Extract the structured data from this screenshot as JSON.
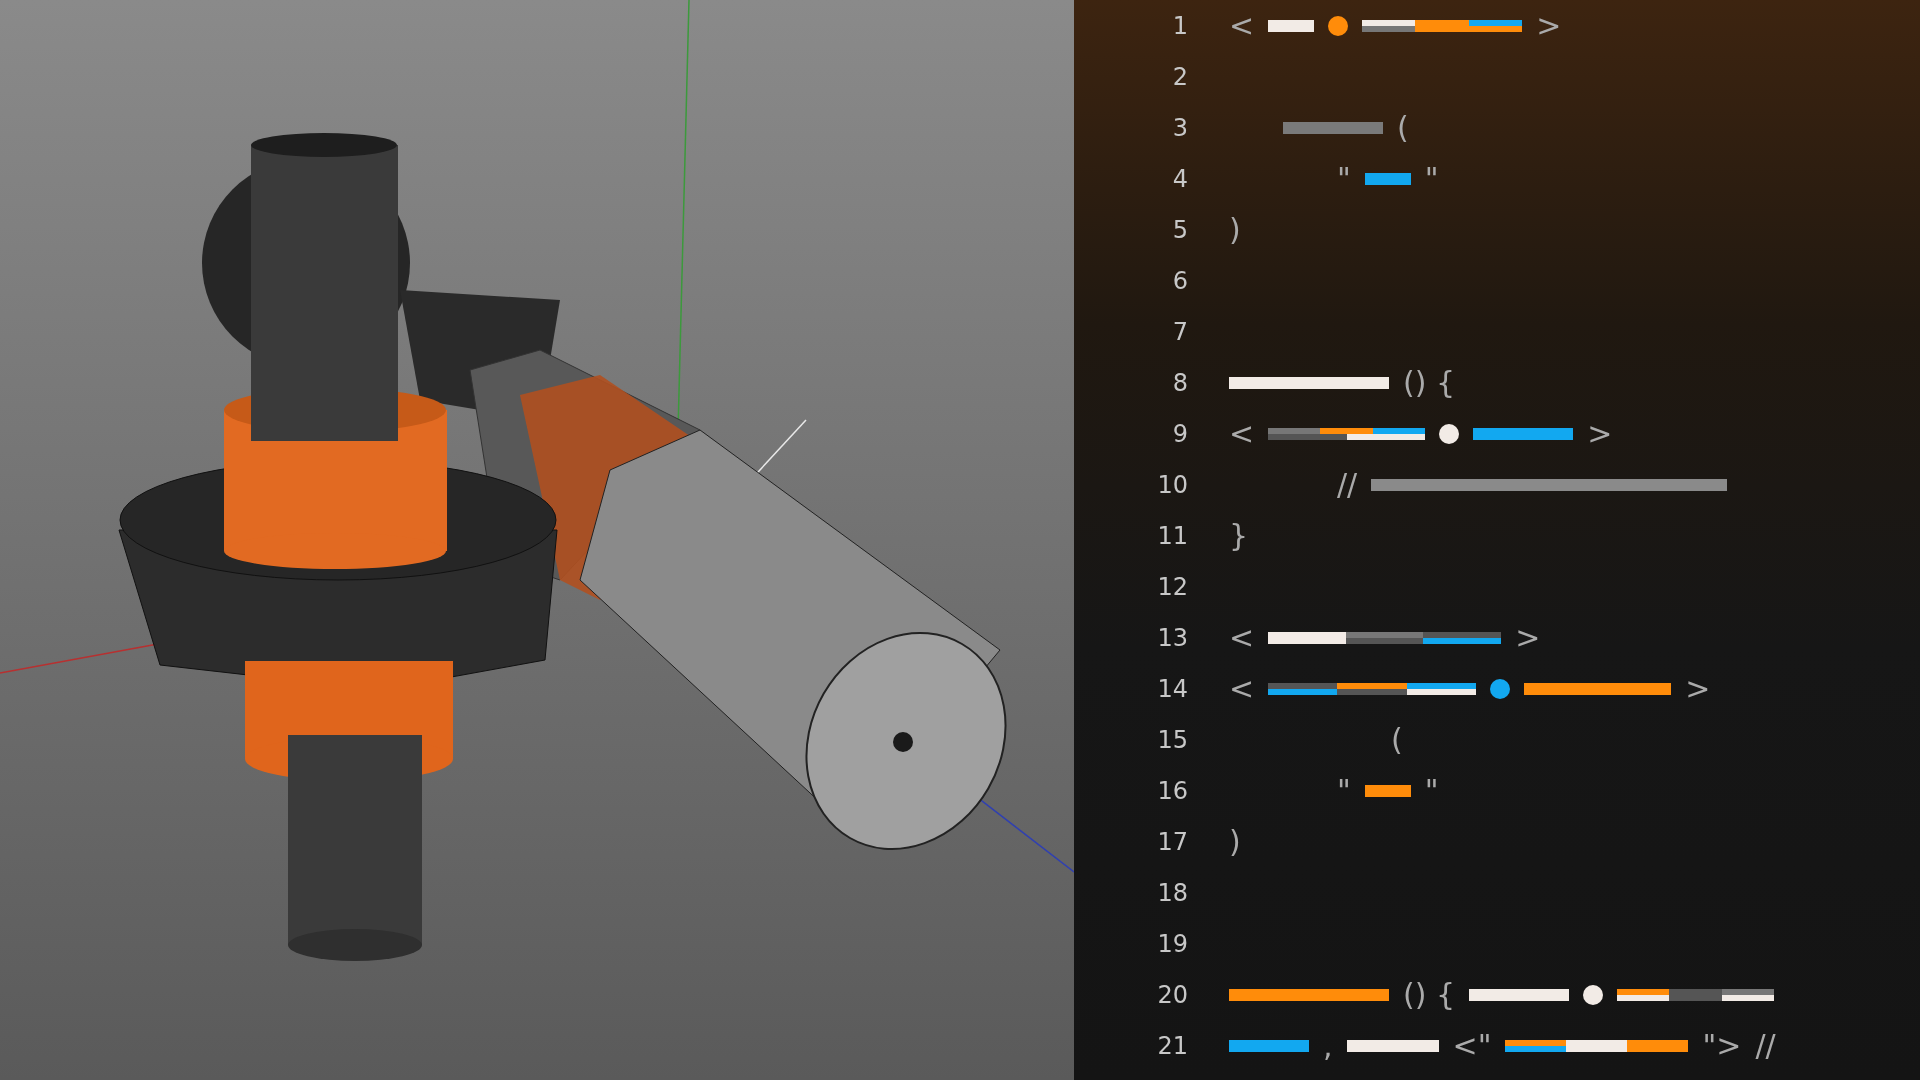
{
  "editor": {
    "lines": [
      {
        "number": "1",
        "tokens": [
          {
            "kind": "text",
            "text": "<"
          },
          {
            "kind": "bar",
            "color": "#f2ebe6"
          },
          {
            "kind": "dot",
            "color": "#ff8c0a"
          },
          {
            "kind": "stack",
            "segments": [
              {
                "color": "#f2ebe6"
              },
              {
                "color": "#ff8c0a"
              },
              {
                "color": "#12a8f0"
              },
              {
                "color": "#777777"
              },
              {
                "color": "#ff8c0a"
              },
              {
                "color": "#ff8c0a"
              }
            ]
          },
          {
            "kind": "text",
            "text": ">"
          }
        ]
      },
      {
        "number": "2"
      },
      {
        "number": "3",
        "tokens": [
          {
            "kind": "bar",
            "color": "#7a7a7a"
          },
          {
            "kind": "text",
            "text": "("
          }
        ]
      },
      {
        "number": "4",
        "tokens": [
          {
            "kind": "text",
            "text": "\""
          },
          {
            "kind": "bar",
            "color": "#12a8f0"
          },
          {
            "kind": "text",
            "text": "\""
          }
        ]
      },
      {
        "number": "5",
        "tokens": [
          {
            "kind": "text",
            "text": ")"
          }
        ]
      },
      {
        "number": "6"
      },
      {
        "number": "7"
      },
      {
        "number": "8",
        "tokens": [
          {
            "kind": "bar",
            "color": "#f2ebe6"
          },
          {
            "kind": "text",
            "text": "() {"
          }
        ]
      },
      {
        "number": "9",
        "tokens": [
          {
            "kind": "text",
            "text": "<"
          },
          {
            "kind": "stack",
            "segments": [
              {
                "color": "#777777"
              },
              {
                "color": "#ff8c0a"
              },
              {
                "color": "#12a8f0"
              },
              {
                "color": "#555555"
              },
              {
                "color": "#f2ebe6"
              }
            ]
          },
          {
            "kind": "dot",
            "color": "#f2ebe6"
          },
          {
            "kind": "bar",
            "color": "#12a8f0"
          },
          {
            "kind": "text",
            "text": ">"
          }
        ]
      },
      {
        "number": "10",
        "tokens": [
          {
            "kind": "text",
            "text": "//"
          },
          {
            "kind": "bar",
            "color": "#8a8a8a"
          }
        ]
      },
      {
        "number": "11",
        "tokens": [
          {
            "kind": "text",
            "text": "}"
          }
        ]
      },
      {
        "number": "12"
      },
      {
        "number": "13",
        "tokens": [
          {
            "kind": "text",
            "text": "<"
          },
          {
            "kind": "stack",
            "segments": [
              {
                "color": "#f2ebe6"
              },
              {
                "color": "#777777"
              },
              {
                "color": "#555555"
              },
              {
                "color": "#f2ebe6"
              },
              {
                "color": "#555555"
              },
              {
                "color": "#12a8f0"
              }
            ]
          },
          {
            "kind": "text",
            "text": ">"
          }
        ]
      },
      {
        "number": "14",
        "tokens": [
          {
            "kind": "text",
            "text": "<"
          },
          {
            "kind": "stack",
            "segments": [
              {
                "color": "#555555"
              },
              {
                "color": "#ff8c0a"
              },
              {
                "color": "#12a8f0"
              },
              {
                "color": "#12a8f0"
              },
              {
                "color": "#555555"
              },
              {
                "color": "#f2ebe6"
              }
            ]
          },
          {
            "kind": "dot",
            "color": "#12a8f0"
          },
          {
            "kind": "bar",
            "color": "#ff8c0a"
          },
          {
            "kind": "text",
            "text": ">"
          }
        ]
      },
      {
        "number": "15",
        "tokens": [
          {
            "kind": "text",
            "text": "("
          }
        ]
      },
      {
        "number": "16",
        "tokens": [
          {
            "kind": "text",
            "text": "\""
          },
          {
            "kind": "bar",
            "color": "#ff8c0a"
          },
          {
            "kind": "text",
            "text": "\""
          }
        ]
      },
      {
        "number": "17",
        "tokens": [
          {
            "kind": "text",
            "text": ")"
          }
        ]
      },
      {
        "number": "18"
      },
      {
        "number": "19"
      },
      {
        "number": "20",
        "tokens": [
          {
            "kind": "bar",
            "color": "#ff8c0a"
          },
          {
            "kind": "text",
            "text": "() {"
          },
          {
            "kind": "bar",
            "color": "#f2ebe6"
          },
          {
            "kind": "dot",
            "color": "#f2ebe6"
          },
          {
            "kind": "stack",
            "segments": [
              {
                "color": "#ff8c0a"
              },
              {
                "color": "#555555"
              },
              {
                "color": "#777777"
              },
              {
                "color": "#f2ebe6"
              },
              {
                "color": "#555555"
              },
              {
                "color": "#f2ebe6"
              }
            ]
          }
        ]
      },
      {
        "number": "21",
        "tokens": [
          {
            "kind": "bar",
            "color": "#12a8f0"
          },
          {
            "kind": "text",
            "text": ","
          },
          {
            "kind": "bar",
            "color": "#f2ebe6"
          },
          {
            "kind": "text",
            "text": "<\""
          },
          {
            "kind": "stack",
            "segments": [
              {
                "color": "#ff8c0a"
              },
              {
                "color": "#f2ebe6"
              },
              {
                "color": "#ff8c0a"
              },
              {
                "color": "#12a8f0"
              },
              {
                "color": "#f2ebe6"
              },
              {
                "color": "#ff8c0a"
              }
            ]
          },
          {
            "kind": "text",
            "text": "\">"
          },
          {
            "kind": "text",
            "text": "//"
          }
        ]
      }
    ]
  }
}
